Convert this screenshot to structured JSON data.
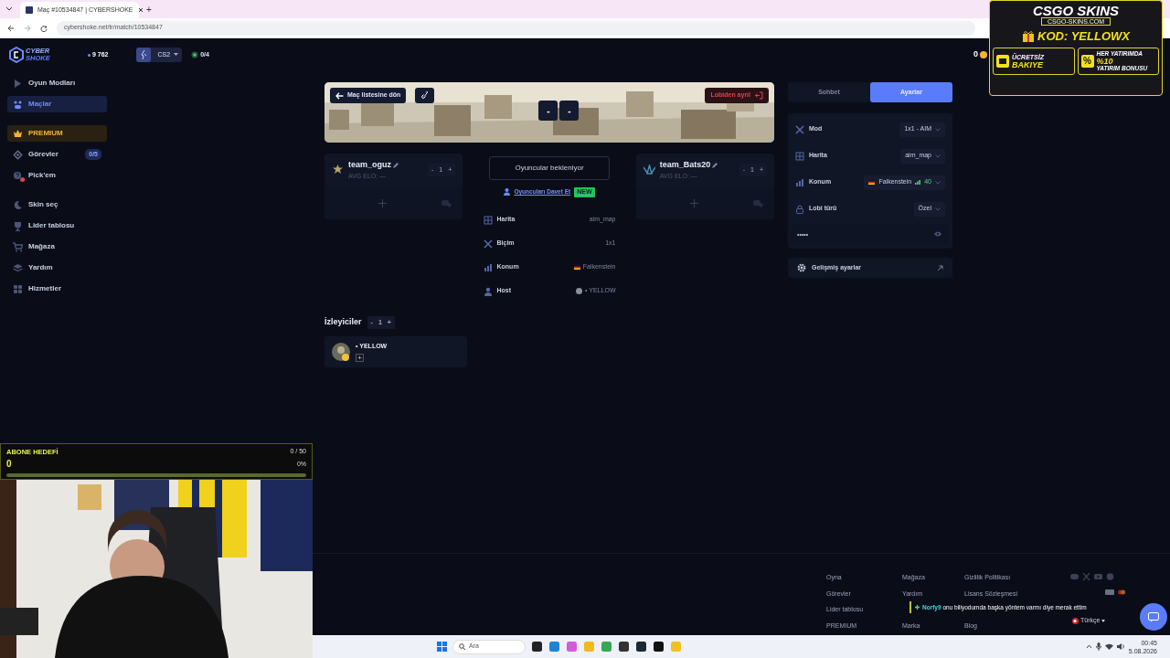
{
  "browser": {
    "tab_title": "Maç #10534847 | CYBERSHOKE",
    "new_tab": "+",
    "url": "cybershoke.net/tr/match/10534847"
  },
  "header": {
    "logo_top": "CYBER",
    "logo_bottom": "SHOKE",
    "points": "9 762",
    "game": "CS2",
    "online": "0/4",
    "coins": "0"
  },
  "sidebar": {
    "groups": [
      [
        {
          "label": "Oyun Modları",
          "selected": false,
          "kind": "link"
        },
        {
          "label": "Maçlar",
          "selected": true,
          "kind": "link"
        }
      ],
      [
        {
          "label": "PREMIUM",
          "selected": false,
          "kind": "premium"
        },
        {
          "label": "Görevler",
          "selected": false,
          "kind": "link",
          "badge": "0/5"
        },
        {
          "label": "Pick'em",
          "selected": false,
          "kind": "link",
          "alert": true
        }
      ],
      [
        {
          "label": "Skin seç",
          "selected": false,
          "kind": "link"
        },
        {
          "label": "Lider tablosu",
          "selected": false,
          "kind": "link"
        },
        {
          "label": "Mağaza",
          "selected": false,
          "kind": "link"
        },
        {
          "label": "Yardım",
          "selected": false,
          "kind": "link"
        },
        {
          "label": "Hizmetler",
          "selected": false,
          "kind": "link"
        }
      ]
    ]
  },
  "banner": {
    "back": "Maç listesine dön",
    "score": [
      "-",
      "-"
    ],
    "leave": "Lobiden ayrıl"
  },
  "teams": [
    {
      "name": "team_oguz",
      "avg_elo": "AVG ELO: —",
      "minus": "-",
      "count": "1",
      "plus": "+"
    },
    {
      "name": "team_Bats20",
      "avg_elo": "AVG ELO: —",
      "minus": "-",
      "count": "1",
      "plus": "+"
    }
  ],
  "lobby": {
    "status": "Oyuncular bekleniyor",
    "invite": "Oyuncuları Davet Et",
    "invite_badge": "NEW",
    "info": [
      {
        "label": "Harita",
        "value": "aim_map",
        "kind": "text"
      },
      {
        "label": "Biçim",
        "value": "1x1",
        "kind": "text"
      },
      {
        "label": "Konum",
        "value": "Falkenstein",
        "kind": "flag"
      },
      {
        "label": "Host",
        "value": "• YELLOW",
        "kind": "avatar"
      }
    ]
  },
  "spectators": {
    "title": "İzleyiciler",
    "minus": "-",
    "count": "1",
    "plus": "+",
    "members": [
      {
        "name": "• YELLOW",
        "add": "+"
      }
    ]
  },
  "panel": {
    "tabs": [
      {
        "label": "Sohbet",
        "selected": false
      },
      {
        "label": "Ayarlar",
        "selected": true
      }
    ],
    "settings": [
      {
        "label": "Mod",
        "value": "1x1 - AIM",
        "kind": "text"
      },
      {
        "label": "Harita",
        "value": "aim_map",
        "kind": "text"
      },
      {
        "label": "Konum",
        "value": "Falkenstein",
        "kind": "location",
        "ping": "40"
      },
      {
        "label": "Lobi türü",
        "value": "Özel",
        "kind": "text"
      }
    ],
    "password": "•••••",
    "advanced": "Gelişmiş ayarlar"
  },
  "footer": {
    "columns": [
      [
        "Oyna",
        "Görevler",
        "Lider tablosu",
        "PREMIUM"
      ],
      [
        "Mağaza",
        "Yardım",
        null,
        "Marka"
      ],
      [
        "Gizlilik Politikası",
        "Lisans Sözleşmesi",
        null,
        "Blog"
      ]
    ],
    "language": "Türkçe"
  },
  "chat_overlay": {
    "user": "Norfy9",
    "message": "onu biliyodumda başka yöntem varmı diye merak ettim"
  },
  "sub_goal": {
    "title": "ABONE HEDEFİ",
    "count": "0",
    "progress": "0 / 50",
    "percent": "0%",
    "level": 0
  },
  "ad": {
    "brand": "CSGO SKINS",
    "site": "CSGO-SKINS.COM",
    "code": "KOD: YELLOWX",
    "offer1": [
      "ÜCRETSİZ",
      "BAKIYE"
    ],
    "percent_sign": "%",
    "offer2": [
      "HER YATIRIMDA",
      "%10",
      "YATIRIM BONUSU"
    ]
  },
  "taskbar": {
    "search": "Ara",
    "time": "00:45",
    "date": "5.08.2026"
  }
}
